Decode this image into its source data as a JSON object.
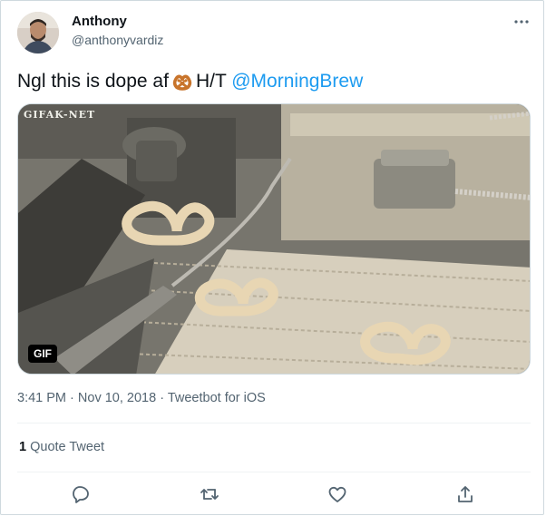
{
  "author": {
    "name": "Anthony",
    "handle": "@anthonyvardiz",
    "avatar_icon": "avatar-photo"
  },
  "tweet": {
    "text_before": "Ngl this is dope af",
    "emoji_icon": "pretzel-emoji",
    "text_hat_tip": "H/T",
    "mention": "@MorningBrew"
  },
  "media": {
    "watermark": "GIFAK-NET",
    "badge": "GIF"
  },
  "meta": {
    "time": "3:41 PM",
    "date": "Nov 10, 2018",
    "source": "Tweetbot for iOS",
    "separator": "·"
  },
  "stats": {
    "quote_count": "1",
    "quote_label": "Quote Tweet"
  },
  "actions": [
    "reply-icon",
    "retweet-icon",
    "like-icon",
    "share-icon"
  ],
  "colors": {
    "accent": "#1d9bf0",
    "text": "#0f1419",
    "secondary": "#536471",
    "border": "#cfd9de"
  }
}
